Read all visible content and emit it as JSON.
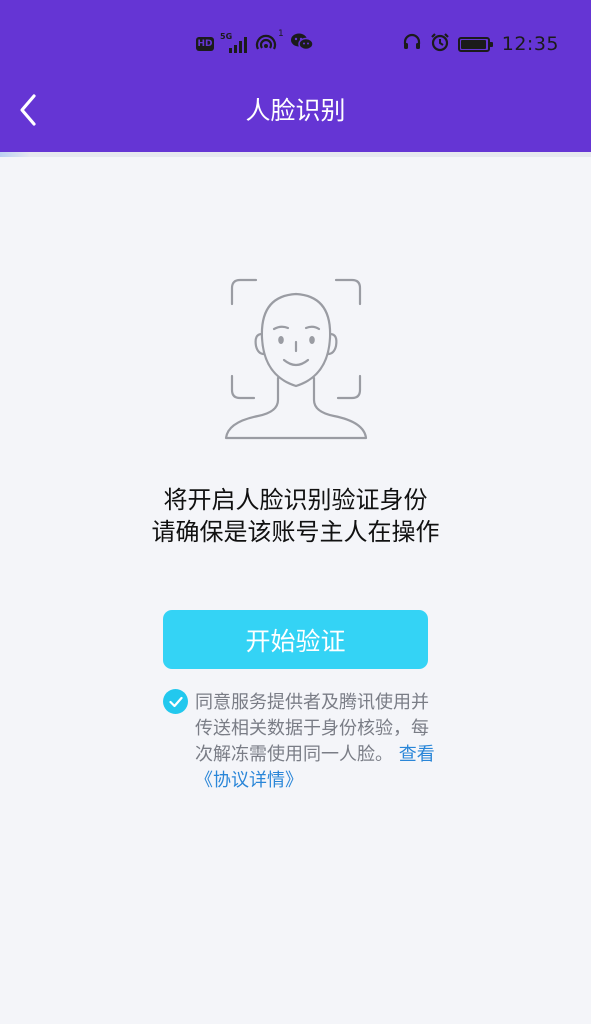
{
  "status_bar": {
    "hd": "HD",
    "net_5g": "5G",
    "net_1": "1",
    "time": "12:35",
    "icons": [
      "signal-icon",
      "hotspot-icon",
      "wechat-icon",
      "headset-icon",
      "alarm-icon",
      "battery-icon"
    ]
  },
  "header": {
    "title": "人脸识别",
    "back_icon": "chevron-left-icon",
    "background_color": "#6535d4"
  },
  "main": {
    "illustration_icon": "face-scan-icon",
    "prompt_line1": "将开启人脸识别验证身份",
    "prompt_line2": "请确保是该账号主人在操作",
    "start_button_label": "开始验证",
    "button_color": "#34d3f5",
    "agreement": {
      "checked": true,
      "text": "同意服务提供者及腾讯使用并传送相关数据于身份核验，每次解冻需使用同一人脸。",
      "link_text": "查看《协议详情》",
      "link_color": "#2a86d8"
    }
  },
  "progress": {
    "fraction": 0.05
  }
}
